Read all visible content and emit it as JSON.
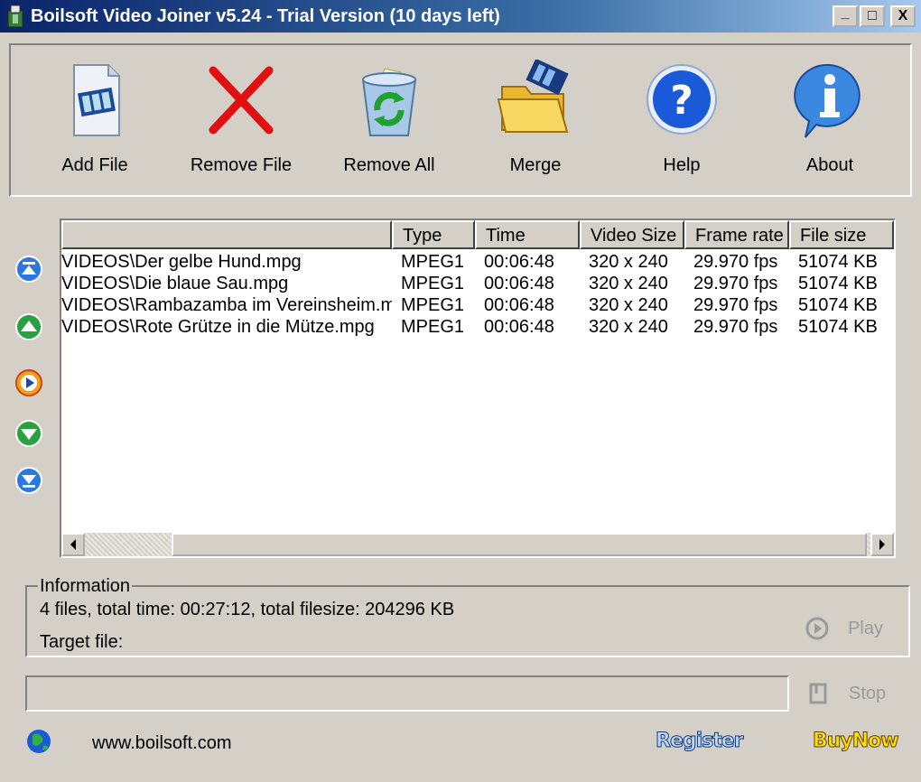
{
  "window": {
    "title": "Boilsoft Video Joiner v5.24 - Trial Version (10 days left)",
    "minimize": "_",
    "maximize": "□",
    "close": "X"
  },
  "toolbar": {
    "add_file": "Add File",
    "remove_file": "Remove File",
    "remove_all": "Remove All",
    "merge": "Merge",
    "help": "Help",
    "about": "About"
  },
  "side_buttons": [
    "move-to-top",
    "move-up",
    "play-preview",
    "move-down",
    "move-to-bottom"
  ],
  "file_list": {
    "columns": [
      "",
      "Type",
      "Time",
      "Video Size",
      "Frame rate",
      "File size"
    ],
    "rows": [
      [
        "VIDEOS\\Der gelbe Hund.mpg",
        "MPEG1",
        "00:06:48",
        "320 x 240",
        "29.970 fps",
        "51074 KB"
      ],
      [
        "VIDEOS\\Die blaue Sau.mpg",
        "MPEG1",
        "00:06:48",
        "320 x 240",
        "29.970 fps",
        "51074 KB"
      ],
      [
        "VIDEOS\\Rambazamba im Vereinsheim.mpg",
        "MPEG1",
        "00:06:48",
        "320 x 240",
        "29.970 fps",
        "51074 KB"
      ],
      [
        "VIDEOS\\Rote Grütze in die Mütze.mpg",
        "MPEG1",
        "00:06:48",
        "320 x 240",
        "29.970 fps",
        "51074 KB"
      ]
    ]
  },
  "information": {
    "legend": "Information",
    "summary": "4 files, total time: 00:27:12, total filesize: 204296 KB",
    "target_label": "Target file:"
  },
  "controls": {
    "play": "Play",
    "stop": "Stop"
  },
  "footer": {
    "website": "www.boilsoft.com",
    "register": "Register",
    "buynow": "BuyNow"
  },
  "colors": {
    "titlebar_start": "#0a246a",
    "window_face": "#d4d0c8",
    "remove_x": "#e01010",
    "help_blue": "#1a5ad8",
    "register_color": "#b8d8ff",
    "buynow_color": "#ffe000"
  }
}
